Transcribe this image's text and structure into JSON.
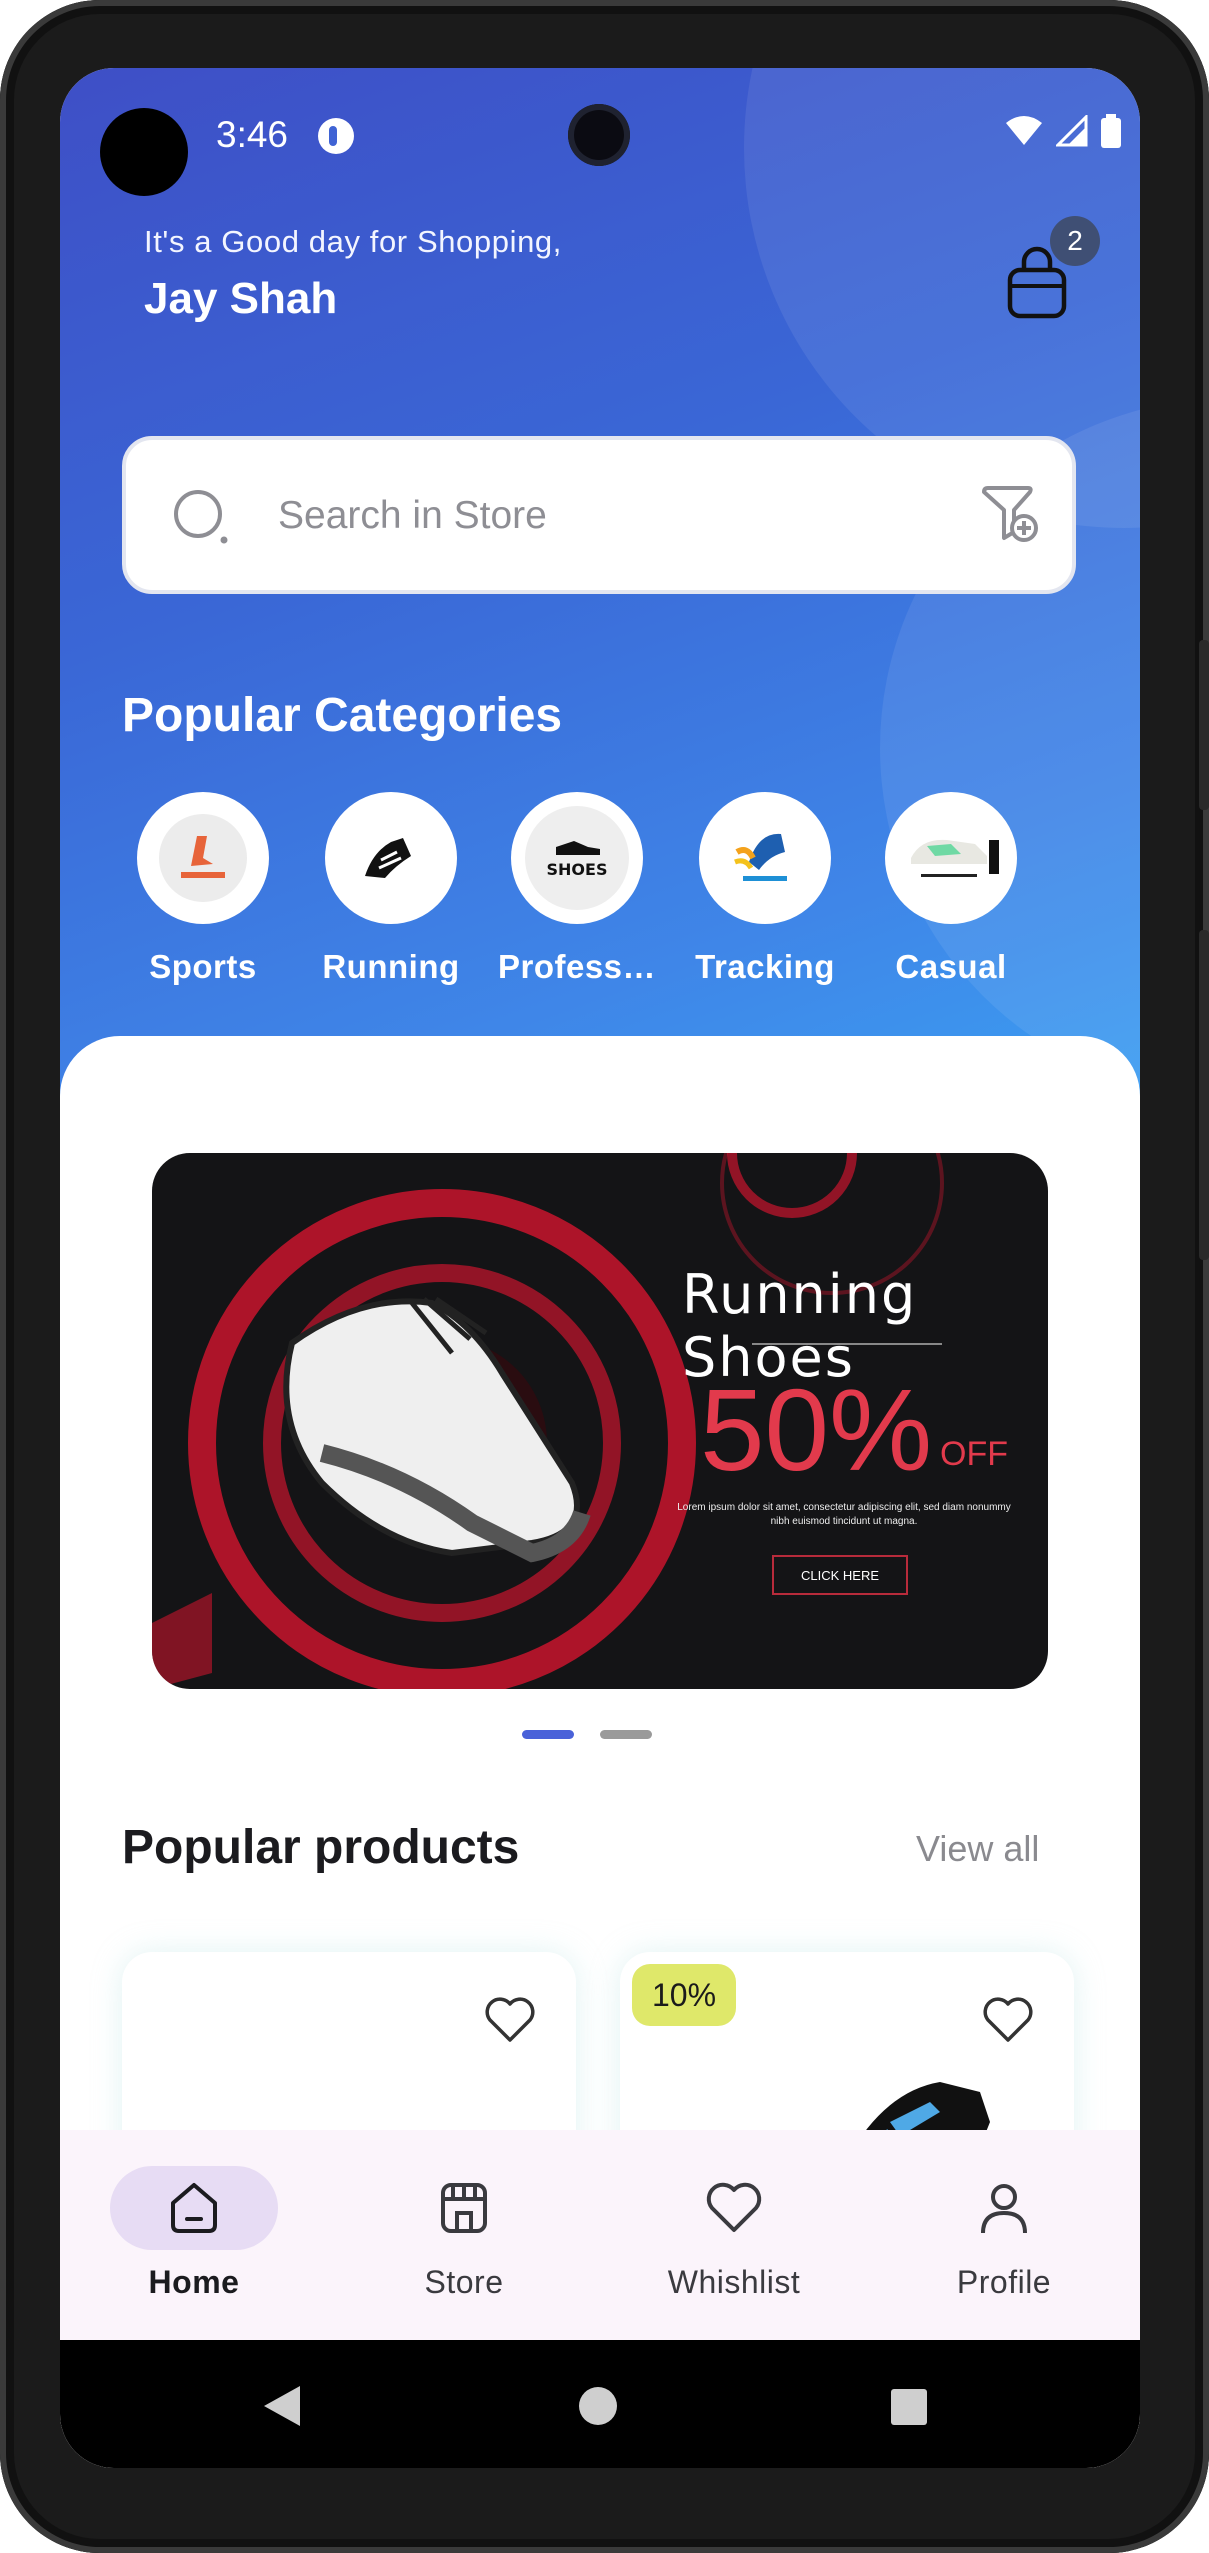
{
  "status_bar": {
    "time": "3:46"
  },
  "header": {
    "greeting": "It's a Good day for Shopping,",
    "user_name": "Jay Shah",
    "cart_count": "2"
  },
  "search": {
    "placeholder": "Search in Store"
  },
  "categories": {
    "title": "Popular Categories",
    "items": [
      {
        "label": "Sports",
        "icon": "sports-shoe-logo"
      },
      {
        "label": "Running",
        "icon": "running-shoe-logo"
      },
      {
        "label": "Profess…",
        "icon": "shoes-logo"
      },
      {
        "label": "Tracking",
        "icon": "track-and-field-logo"
      },
      {
        "label": "Casual",
        "icon": "casual-shoes-logo"
      }
    ]
  },
  "banner": {
    "title": "Running Shoes",
    "discount": "50%",
    "off": "OFF",
    "body": "Lorem ipsum dolor sit amet, consectetur adipiscing elit, sed diam nonummy nibh euismod tincidunt ut magna.",
    "button": "CLICK HERE",
    "active_slide": 1,
    "slide_count": 2
  },
  "products": {
    "title": "Popular products",
    "view_all": "View all",
    "items": [
      {
        "discount": ""
      },
      {
        "discount": "10%"
      }
    ]
  },
  "bottom_nav": [
    {
      "label": "Home",
      "icon": "home-icon",
      "active": true
    },
    {
      "label": "Store",
      "icon": "store-icon",
      "active": false
    },
    {
      "label": "Whishlist",
      "icon": "heart-icon",
      "active": false
    },
    {
      "label": "Profile",
      "icon": "profile-icon",
      "active": false
    }
  ],
  "colors": {
    "header_gradient_start": "#3e4fc6",
    "header_gradient_end": "#3aa2f3",
    "accent": "#4a62d9",
    "badge_discount": "#dfe86a",
    "nav_active_pill": "#e7dcf4",
    "banner_red": "#e23a4c"
  }
}
